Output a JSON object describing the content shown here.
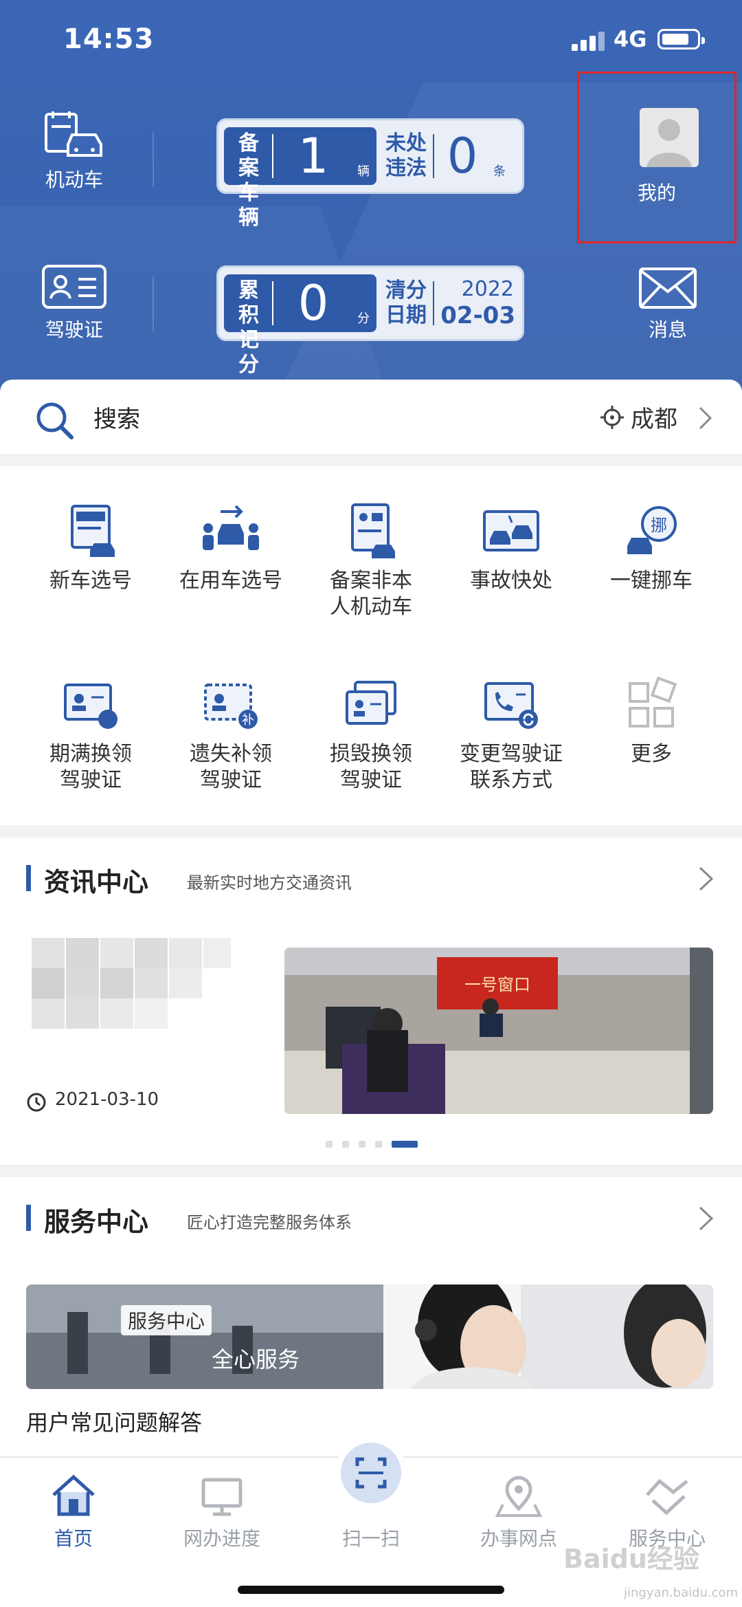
{
  "status": {
    "time": "14:53",
    "network": "4G"
  },
  "header": {
    "vehicle_label": "机动车",
    "license_label": "驾驶证",
    "mine_label": "我的",
    "message_label": "消息",
    "plate1": {
      "k1": "备案车辆",
      "v1": "1",
      "u1": "辆",
      "k2": "未处违法",
      "v2": "0",
      "u2": "条"
    },
    "plate2": {
      "k1": "累积记分",
      "v1": "0",
      "u1": "分",
      "k2": "清分日期",
      "year": "2022",
      "date": "02-03"
    }
  },
  "search": {
    "placeholder": "搜索",
    "city": "成都"
  },
  "services": [
    {
      "label": "新车选号"
    },
    {
      "label": "在用车选号"
    },
    {
      "label": "备案非本\n人机动车"
    },
    {
      "label": "事故快处"
    },
    {
      "label": "一键挪车"
    },
    {
      "label": "期满换领\n驾驶证"
    },
    {
      "label": "遗失补领\n驾驶证"
    },
    {
      "label": "损毁换领\n驾驶证"
    },
    {
      "label": "变更驾驶证\n联系方式"
    },
    {
      "label": "更多"
    }
  ],
  "news": {
    "title": "资讯中心",
    "subtitle": "最新实时地方交通资讯",
    "date": "2021-03-10",
    "photo_sign": "一号窗口"
  },
  "service_center": {
    "title": "服务中心",
    "subtitle": "匠心打造完整服务体系",
    "banner_tag": "服务中心",
    "banner_slogan": "全心服务",
    "faq": "用户常见问题解答"
  },
  "tabs": [
    {
      "label": "首页"
    },
    {
      "label": "网办进度"
    },
    {
      "label": "扫一扫"
    },
    {
      "label": "办事网点"
    },
    {
      "label": "服务中心"
    }
  ],
  "watermark": {
    "brand": "Baidu经验",
    "url": "jingyan.baidu.com"
  },
  "colors": {
    "primary": "#2e5aa8",
    "header_bg": "#3b67b6",
    "highlight_border": "#e0262a"
  }
}
